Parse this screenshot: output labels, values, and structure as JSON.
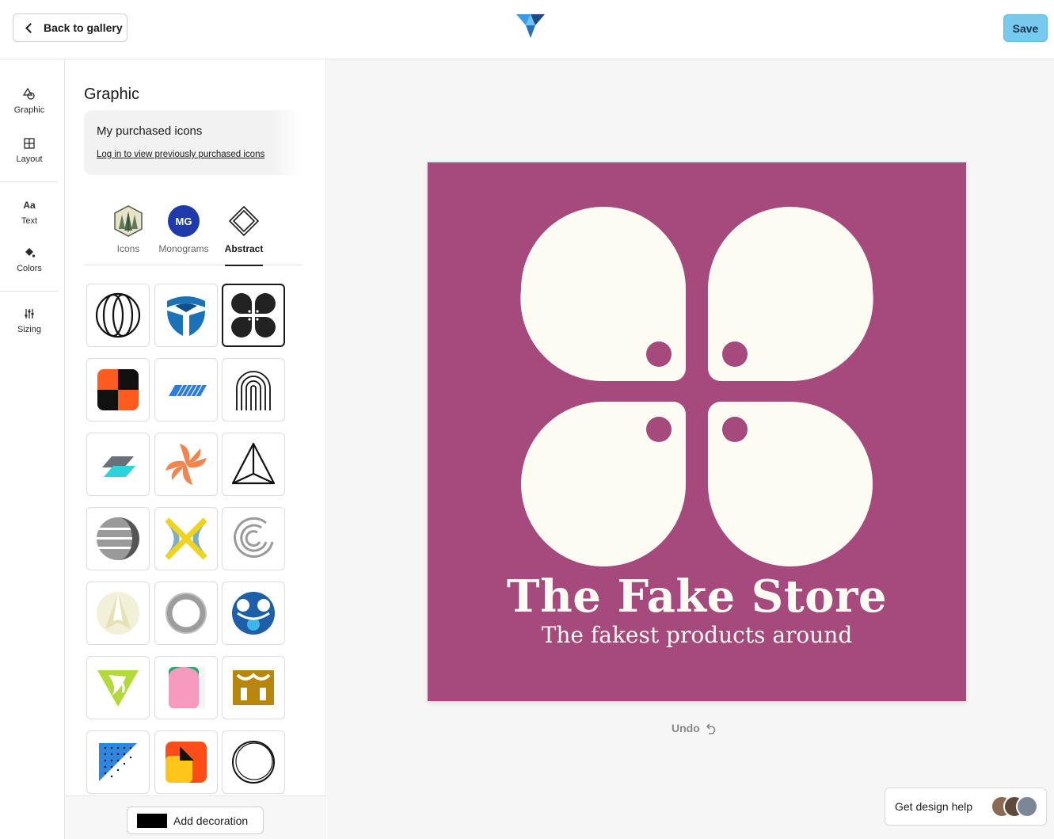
{
  "header": {
    "back_label": "Back to gallery",
    "save_label": "Save"
  },
  "rail": {
    "items": [
      {
        "label": "Graphic",
        "icon": "shapes-icon"
      },
      {
        "label": "Layout",
        "icon": "layout-icon"
      },
      {
        "label": "Text",
        "icon": "text-icon"
      },
      {
        "label": "Colors",
        "icon": "paint-bucket-icon"
      },
      {
        "label": "Sizing",
        "icon": "sliders-icon"
      }
    ],
    "text_glyph": "Aa"
  },
  "panel": {
    "title": "Graphic",
    "purchased": {
      "title": "My purchased icons",
      "link": "Log in to view previously purchased icons"
    },
    "tabs": [
      {
        "label": "Icons",
        "active": false
      },
      {
        "label": "Monograms",
        "active": false,
        "badge": "MG"
      },
      {
        "label": "Abstract",
        "active": true
      }
    ],
    "add_decoration_label": "Add decoration"
  },
  "canvas": {
    "background": "#a6497c",
    "brand_name": "The Fake Store",
    "tagline": "The fakest products around",
    "foreground": "#fdfcf2",
    "undo_label": "Undo"
  },
  "help": {
    "label": "Get design help"
  }
}
